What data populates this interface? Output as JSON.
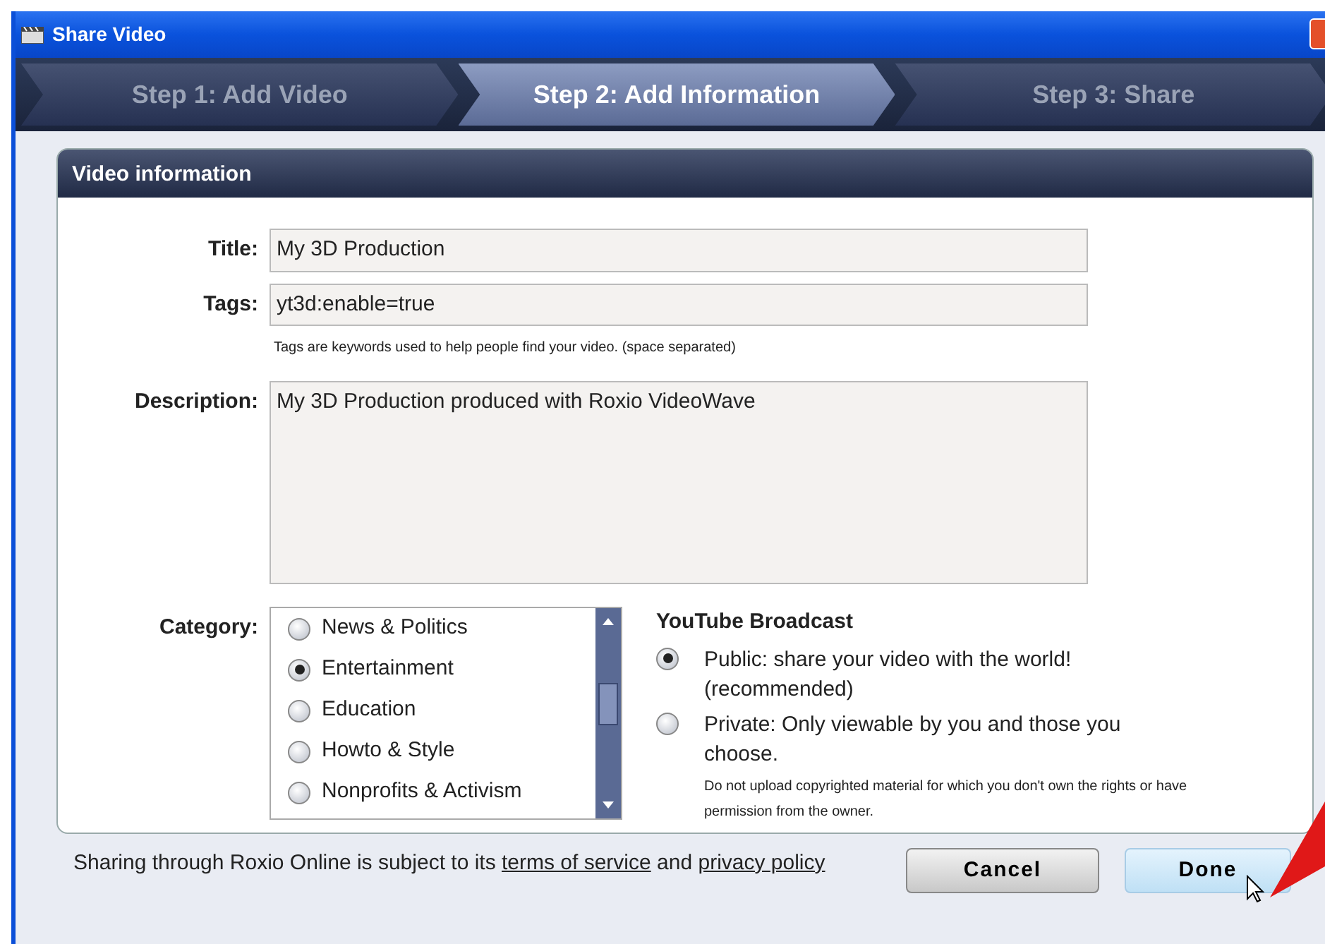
{
  "window": {
    "title": "Share Video"
  },
  "steps": [
    {
      "label": "Step 1: Add Video",
      "selected": false
    },
    {
      "label": "Step 2: Add Information",
      "selected": true
    },
    {
      "label": "Step 3: Share",
      "selected": false
    }
  ],
  "panel": {
    "title": "Video information"
  },
  "fields": [
    {
      "label": "Title:",
      "value": "My 3D Production",
      "kind": "line"
    },
    {
      "label": "Tags:",
      "value": "yt3d:enable=true",
      "kind": "line",
      "hint": "Tags are keywords used to help people find your video. (space separated)"
    },
    {
      "label": "Description:",
      "value": "My 3D Production produced with Roxio VideoWave",
      "kind": "area"
    }
  ],
  "category": {
    "label": "Category:",
    "options": [
      {
        "label": "News & Politics",
        "selected": false
      },
      {
        "label": "Entertainment",
        "selected": true
      },
      {
        "label": "Education",
        "selected": false
      },
      {
        "label": "Howto & Style",
        "selected": false
      },
      {
        "label": "Nonprofits & Activism",
        "selected": false
      }
    ]
  },
  "broadcast": {
    "title": "YouTube Broadcast",
    "options": [
      {
        "label": "Public: share your video with the world! (recommended)",
        "selected": true
      },
      {
        "label": "Private: Only viewable by you and those you choose.",
        "selected": false
      }
    ],
    "note": "Do not upload copyrighted material for which you don't own the rights or have permission from the owner."
  },
  "footer": [
    {
      "kind": "text",
      "text": "Sharing through Roxio Online is subject to its"
    },
    {
      "kind": "link",
      "text": "terms of service"
    },
    {
      "kind": "text",
      "text": "and"
    },
    {
      "kind": "link",
      "text": "privacy policy"
    }
  ],
  "buttons": [
    {
      "label": "Cancel",
      "kind": "secondary"
    },
    {
      "label": "Done",
      "kind": "primary"
    }
  ]
}
